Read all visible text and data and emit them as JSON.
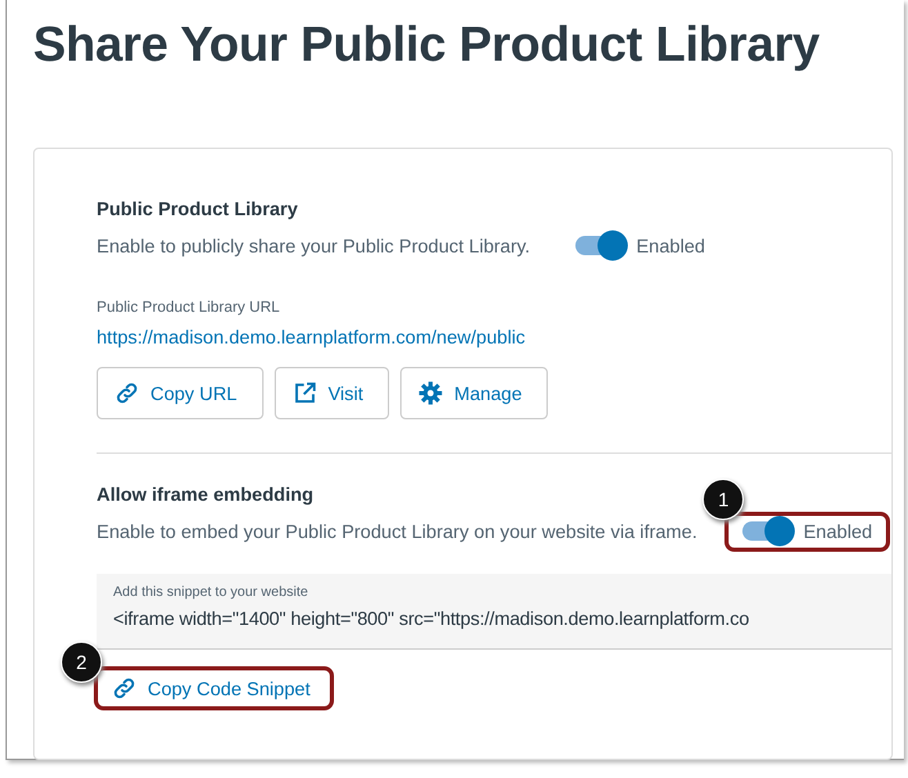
{
  "page": {
    "title": "Share Your Public Product Library"
  },
  "library": {
    "heading": "Public Product Library",
    "description": "Enable to publicly share your Public Product Library.",
    "toggle": {
      "on": true,
      "label": "Enabled"
    },
    "url_label": "Public Product Library URL",
    "url": "https://madison.demo.learnplatform.com/new/public",
    "buttons": [
      {
        "kind": "link",
        "label": "Copy URL"
      },
      {
        "kind": "external",
        "label": "Visit"
      },
      {
        "kind": "gear",
        "label": "Manage"
      }
    ]
  },
  "iframe": {
    "heading": "Allow iframe embedding",
    "description": "Enable to embed your Public Product Library on your website via iframe.",
    "toggle": {
      "on": true,
      "label": "Enabled",
      "callout": "1"
    },
    "snippet_label": "Add this snippet to your website",
    "snippet": "<iframe width=\"1400\" height=\"800\" src=\"https://madison.demo.learnplatform.co",
    "copy_button": {
      "label": "Copy Code Snippet",
      "callout": "2"
    }
  }
}
